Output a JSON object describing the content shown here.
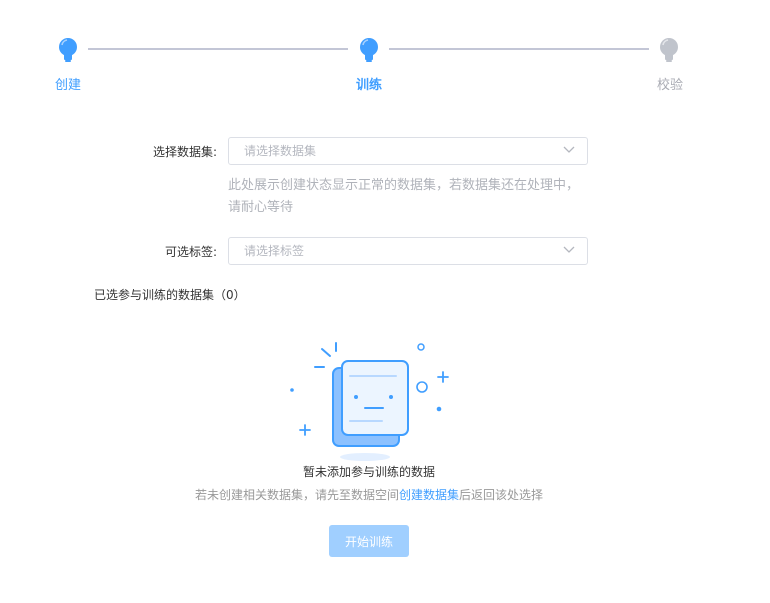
{
  "steps": [
    {
      "label": "创建",
      "state": "done"
    },
    {
      "label": "训练",
      "state": "active"
    },
    {
      "label": "校验",
      "state": "pending"
    }
  ],
  "form": {
    "dataset": {
      "label": "选择数据集:",
      "placeholder": "请选择数据集",
      "hint": "此处展示创建状态显示正常的数据集，若数据集还在处理中，请耐心等待"
    },
    "tags": {
      "label": "可选标签:",
      "placeholder": "请选择标签"
    }
  },
  "selected_title": "已选参与训练的数据集（0）",
  "empty": {
    "title": "暂未添加参与训练的数据",
    "desc_before": "若未创建相关数据集，请先至数据空间",
    "desc_link": "创建数据集",
    "desc_after": "后返回该处选择"
  },
  "start_button": "开始训练",
  "colors": {
    "primary": "#409eff",
    "disabled_button": "#a0cfff",
    "step_pending": "#c0c4cc",
    "step_line": "#c3c6d6"
  },
  "icons": {
    "step_marker": "bulb-icon",
    "select_arrow": "chevron-down-icon",
    "empty_illustration": "empty-document-icon"
  }
}
